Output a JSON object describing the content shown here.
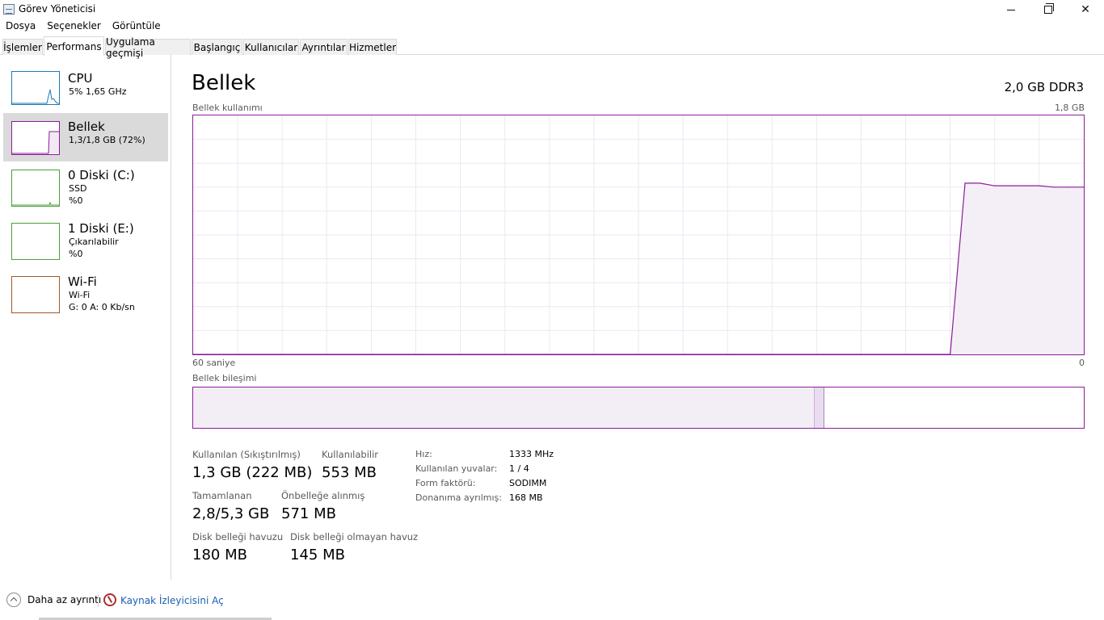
{
  "window": {
    "title": "Görev Yöneticisi"
  },
  "menu": [
    "Dosya",
    "Seçenekler",
    "Görüntüle"
  ],
  "tabs": [
    "İşlemler",
    "Performans",
    "Uygulama geçmişi",
    "Başlangıç",
    "Kullanıcılar",
    "Ayrıntılar",
    "Hizmetler"
  ],
  "active_tab": "Performans",
  "sidebar": {
    "items": [
      {
        "name": "CPU",
        "line1": "5%  1,65 GHz",
        "line2": "",
        "color": "#1f7ab5"
      },
      {
        "name": "Bellek",
        "line1": "1,3/1,8 GB (72%)",
        "line2": "",
        "color": "#8b1c9b"
      },
      {
        "name": "0 Diski (C:)",
        "line1": "SSD",
        "line2": "%0",
        "color": "#4ca13a"
      },
      {
        "name": "1 Diski (E:)",
        "line1": "Çıkarılabilir",
        "line2": "%0",
        "color": "#4ca13a"
      },
      {
        "name": "Wi-Fi",
        "line1": "Wi-Fi",
        "line2": "G: 0 A: 0 Kb/sn",
        "color": "#a0592a"
      }
    ]
  },
  "main": {
    "title": "Bellek",
    "memory_type": "2,0 GB DDR3",
    "usage_label": "Bellek kullanımı",
    "usage_max": "1,8 GB",
    "time_left": "60 saniye",
    "time_right": "0",
    "composition_label": "Bellek bileşimi",
    "composition": {
      "in_use_fraction": 0.698,
      "modified_fraction": 0.011
    },
    "stats": {
      "in_use_label": "Kullanılan (Sıkıştırılmış)",
      "in_use_value": "1,3 GB (222 MB)",
      "available_label": "Kullanılabilir",
      "available_value": "553 MB",
      "committed_label": "Tamamlanan",
      "committed_value": "2,8/5,3 GB",
      "cached_label": "Önbelleğe alınmış",
      "cached_value": "571 MB",
      "paged_label": "Disk belleği havuzu",
      "paged_value": "180 MB",
      "nonpaged_label": "Disk belleği olmayan havuz",
      "nonpaged_value": "145 MB"
    },
    "details": [
      {
        "label": "Hız:",
        "value": "1333 MHz"
      },
      {
        "label": "Kullanılan yuvalar:",
        "value": "1 / 4"
      },
      {
        "label": "Form faktörü:",
        "value": "SODIMM"
      },
      {
        "label": "Donanıma ayrılmış:",
        "value": "168 MB"
      }
    ]
  },
  "footer": {
    "less_details": "Daha az ayrıntı",
    "resource_monitor": "Kaynak İzleyicisini Aç"
  },
  "chart_data": {
    "type": "area",
    "x": [
      60,
      9,
      8,
      7,
      6,
      5,
      4,
      3,
      2,
      1,
      0
    ],
    "y": [
      0,
      0,
      1.29,
      1.29,
      1.27,
      1.27,
      1.27,
      1.27,
      1.26,
      1.26,
      1.26
    ],
    "xlabel_left": "60 saniye",
    "xlabel_right": "0",
    "ylim": [
      0,
      1.8
    ],
    "unit": "GB",
    "grid": true,
    "color": "#8b1c9b"
  }
}
